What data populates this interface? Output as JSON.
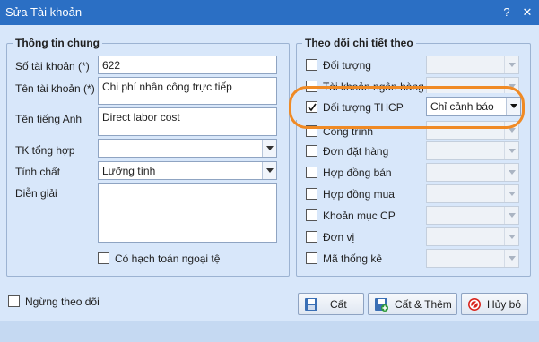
{
  "window": {
    "title": "Sửa Tài khoản",
    "help_glyph": "?",
    "close_glyph": "✕"
  },
  "general": {
    "legend": "Thông tin chung",
    "account_no_label": "Số tài khoản (*)",
    "account_no_value": "622",
    "account_name_label": "Tên tài khoản (*)",
    "account_name_value": "Chi phí nhân công trực tiếp",
    "english_name_label": "Tên tiếng Anh",
    "english_name_value": "Direct labor cost",
    "parent_account_label": "TK tổng hợp",
    "parent_account_value": "",
    "nature_label": "Tính chất",
    "nature_value": "Lưỡng tính",
    "description_label": "Diễn giải",
    "description_value": "",
    "foreign_currency_label": "Có hạch toán ngoại tệ",
    "foreign_currency_checked": false
  },
  "tracking": {
    "legend": "Theo dõi chi tiết theo",
    "items": [
      {
        "label": "Đối tượng",
        "checked": false,
        "value": ""
      },
      {
        "label": "Tài khoản ngân hàng",
        "checked": false,
        "value": ""
      },
      {
        "label": "Đối tượng THCP",
        "checked": true,
        "value": "Chỉ cảnh báo"
      },
      {
        "label": "Công trình",
        "checked": false,
        "value": ""
      },
      {
        "label": "Đơn đặt hàng",
        "checked": false,
        "value": ""
      },
      {
        "label": "Hợp đồng bán",
        "checked": false,
        "value": ""
      },
      {
        "label": "Hợp đồng mua",
        "checked": false,
        "value": ""
      },
      {
        "label": "Khoản mục CP",
        "checked": false,
        "value": ""
      },
      {
        "label": "Đơn vị",
        "checked": false,
        "value": ""
      },
      {
        "label": "Mã thống kê",
        "checked": false,
        "value": ""
      }
    ]
  },
  "footer": {
    "inactive_label": "Ngừng theo dõi",
    "inactive_checked": false,
    "save_label": "Cất",
    "save_add_label": "Cất & Thêm",
    "cancel_label": "Hủy bỏ"
  },
  "colors": {
    "titlebar": "#2b6fc4",
    "client": "#d8e7fa",
    "highlight": "#f08a24",
    "cancel_icon": "#d9241c"
  },
  "icons": {
    "save": "floppy-disk-icon",
    "save_add": "floppy-disk-plus-icon",
    "cancel": "no-entry-icon"
  }
}
